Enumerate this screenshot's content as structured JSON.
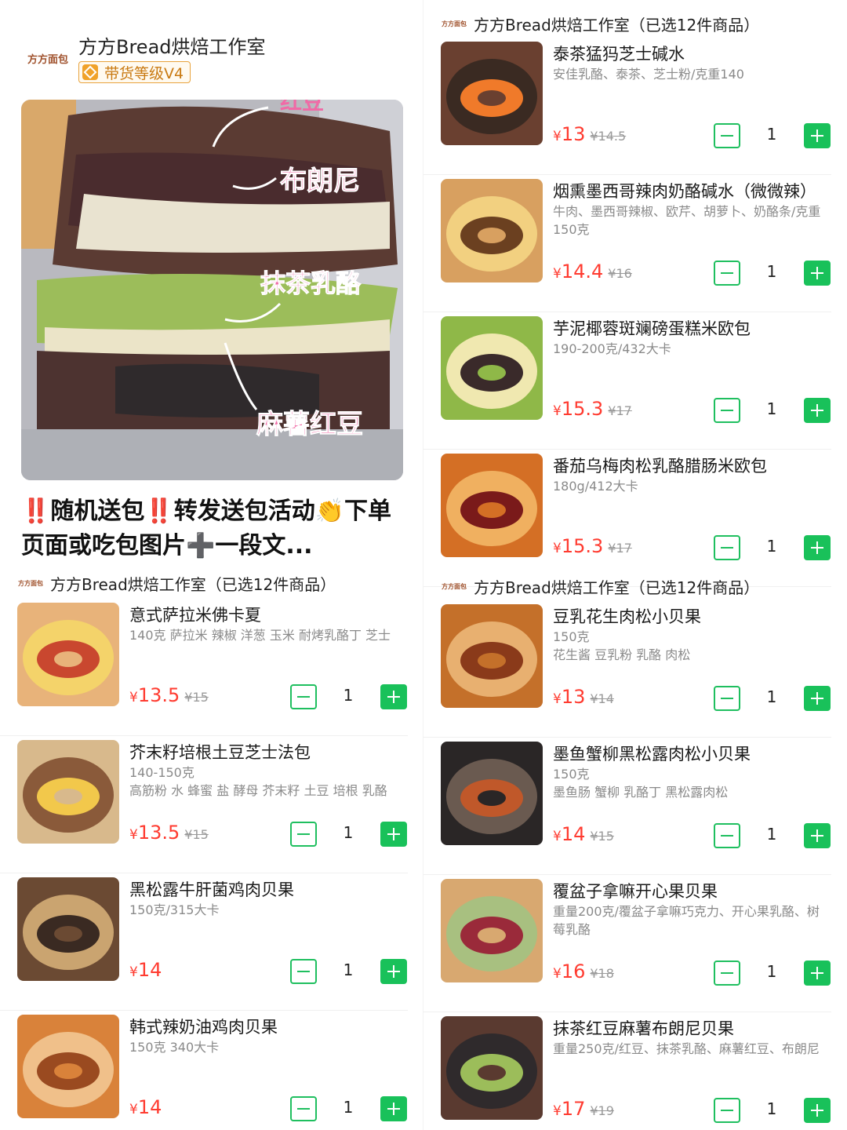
{
  "shop": {
    "logo_text": "方方面包",
    "name": "方方Bread烘焙工作室",
    "badge": "带货等级V4"
  },
  "hero": {
    "labels": [
      "红豆",
      "布朗尼",
      "抹茶乳酪",
      "麻薯红豆"
    ]
  },
  "post": {
    "title": "‼️随机送包‼️转发送包活动👏下单页面或吃包图片➕一段文..."
  },
  "store_strip": {
    "text": "方方Bread烘焙工作室（已选12件商品）"
  },
  "colors": {
    "green": "#19c15a",
    "price_red": "#ff3b30",
    "badge_orange": "#e8a33c"
  },
  "products_left": [
    {
      "name": "意式萨拉米佛卡夏",
      "desc": "140克 萨拉米 辣椒 洋葱 玉米 耐烤乳酪丁 芝士",
      "cur": "¥",
      "price": "13.5",
      "was": "¥15",
      "qty": "1"
    },
    {
      "name": "芥末籽培根土豆芝士法包",
      "desc": "140-150克\n高筋粉 水 蜂蜜 盐 酵母 芥末籽 土豆 培根 乳酪",
      "cur": "¥",
      "price": "13.5",
      "was": "¥15",
      "qty": "1"
    },
    {
      "name": "黑松露牛肝菌鸡肉贝果",
      "desc": "150克/315大卡",
      "cur": "¥",
      "price": "14",
      "was": "",
      "qty": "1"
    },
    {
      "name": "韩式辣奶油鸡肉贝果",
      "desc": "150克 340大卡",
      "cur": "¥",
      "price": "14",
      "was": "",
      "qty": "1"
    }
  ],
  "products_right_a": [
    {
      "name": "泰茶猛犸芝士碱水",
      "desc": "安佳乳酪、泰茶、芝士粉/克重140",
      "cur": "¥",
      "price": "13",
      "was": "¥14.5",
      "qty": "1"
    },
    {
      "name": "烟熏墨西哥辣肉奶酪碱水（微微辣）",
      "desc": "牛肉、墨西哥辣椒、欧芹、胡萝卜、奶酪条/克重150克",
      "cur": "¥",
      "price": "14.4",
      "was": "¥16",
      "qty": "1"
    },
    {
      "name": "芋泥椰蓉斑斓磅蛋糕米欧包",
      "desc": "190-200克/432大卡",
      "cur": "¥",
      "price": "15.3",
      "was": "¥17",
      "qty": "1"
    },
    {
      "name": "番茄乌梅肉松乳酪腊肠米欧包",
      "desc": "180g/412大卡",
      "cur": "¥",
      "price": "15.3",
      "was": "¥17",
      "qty": "1"
    }
  ],
  "products_right_b": [
    {
      "name": "豆乳花生肉松小贝果",
      "desc": "150克\n花生酱 豆乳粉 乳酪 肉松",
      "cur": "¥",
      "price": "13",
      "was": "¥14",
      "qty": "1"
    },
    {
      "name": "墨鱼蟹柳黑松露肉松小贝果",
      "desc": "150克\n墨鱼肠 蟹柳 乳酪丁 黑松露肉松",
      "cur": "¥",
      "price": "14",
      "was": "¥15",
      "qty": "1"
    },
    {
      "name": "覆盆子拿嘛开心果贝果",
      "desc": "重量200克/覆盆子拿嘛巧克力、开心果乳酪、树莓乳酪",
      "cur": "¥",
      "price": "16",
      "was": "¥18",
      "qty": "1"
    },
    {
      "name": "抹茶红豆麻薯布朗尼贝果",
      "desc": "重量250克/红豆、抹茶乳酪、麻薯红豆、布朗尼",
      "cur": "¥",
      "price": "17",
      "was": "¥19",
      "qty": "1"
    }
  ]
}
